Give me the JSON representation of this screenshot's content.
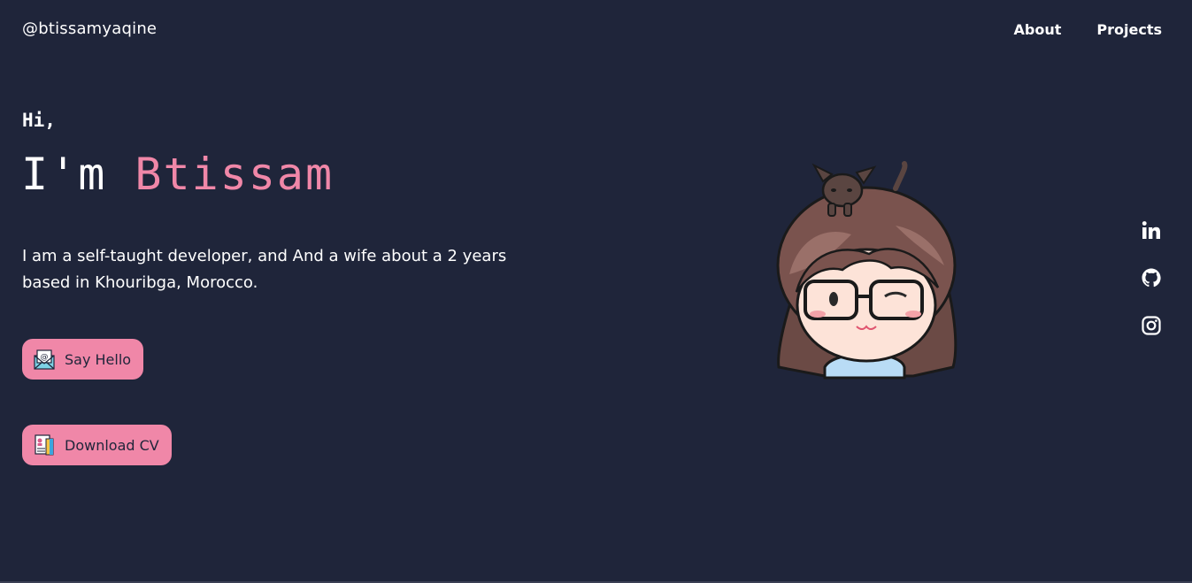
{
  "nav": {
    "brand": "@btissamyaqine",
    "links": [
      "About",
      "Projects"
    ]
  },
  "hero": {
    "greeting": "Hi,",
    "name_prefix": "I'm",
    "name": "Btissam",
    "intro": "I am a self-taught developer, and And a wife about a 2 years based in Khouribga, Morocco."
  },
  "buttons": {
    "say_hello": "Say Hello",
    "download_cv": "Download CV"
  },
  "socials": {
    "items": [
      "linkedin-icon",
      "github-icon",
      "instagram-icon"
    ]
  },
  "colors": {
    "background": "#1f253a",
    "accent": "#f087a8",
    "text": "#ffffff"
  }
}
